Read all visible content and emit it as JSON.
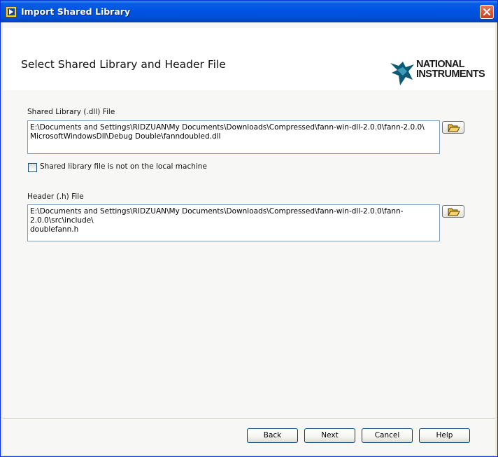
{
  "window": {
    "title": "Import Shared Library",
    "icon": "labview-icon",
    "close_icon": "close-icon"
  },
  "header": {
    "title": "Select Shared Library and Header File",
    "logo": {
      "line1": "NATIONAL",
      "line2": "INSTRUMENTS",
      "icon": "ni-eagle-icon"
    }
  },
  "shared_library": {
    "label": "Shared Library (.dll) File",
    "path_line1": "E:\\Documents and Settings\\RIDZUAN\\My Documents\\Downloads\\Compressed\\fann-win-dll-2.0.0\\fann-2.0.0\\",
    "path_line2": "MicrosoftWindowsDll\\Debug Double\\fanndoubled.dll",
    "browse_icon": "folder-open-icon",
    "remote_checkbox": {
      "label": "Shared library file is not on the local machine",
      "checked": false
    }
  },
  "header_file": {
    "label": "Header (.h) File",
    "path_line1": "E:\\Documents and Settings\\RIDZUAN\\My Documents\\Downloads\\Compressed\\fann-win-dll-2.0.0\\fann-2.0.0\\src\\include\\",
    "path_line2": "doublefann.h",
    "browse_icon": "folder-open-icon"
  },
  "buttons": {
    "back": "Back",
    "next": "Next",
    "cancel": "Cancel",
    "help": "Help"
  },
  "colors": {
    "titlebar": "#0054e3",
    "dialog_bg": "#f7f7f5",
    "close_button": "#c8401e"
  }
}
